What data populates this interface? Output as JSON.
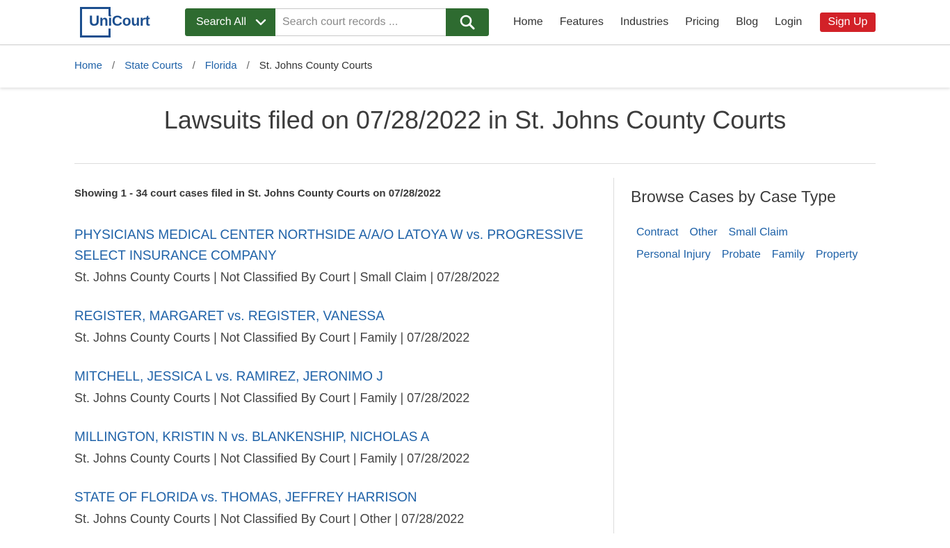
{
  "header": {
    "logo_text": "UniCourt",
    "search_all_label": "Search All",
    "search_placeholder": "Search court records ...",
    "nav": [
      "Home",
      "Features",
      "Industries",
      "Pricing",
      "Blog",
      "Login"
    ],
    "signup_label": "Sign Up"
  },
  "breadcrumb": {
    "items": [
      "Home",
      "State Courts",
      "Florida"
    ],
    "current": "St. Johns County Courts"
  },
  "page_title": "Lawsuits filed on 07/28/2022 in St. Johns County Courts",
  "showing": "Showing 1 - 34 court cases filed in St. Johns County Courts on 07/28/2022",
  "cases": [
    {
      "title_line1": "PHYSICIANS MEDICAL CENTER NORTHSIDE A/A/O LATOYA W vs. PROGRESSIVE",
      "title_line2": "SELECT INSURANCE COMPANY",
      "meta": "St. Johns County Courts | Not Classified By Court | Small Claim | 07/28/2022"
    },
    {
      "title_line1": "REGISTER, MARGARET vs. REGISTER, VANESSA",
      "title_line2": "",
      "meta": "St. Johns County Courts | Not Classified By Court | Family | 07/28/2022"
    },
    {
      "title_line1": "MITCHELL, JESSICA L vs. RAMIREZ, JERONIMO J",
      "title_line2": "",
      "meta": "St. Johns County Courts | Not Classified By Court | Family | 07/28/2022"
    },
    {
      "title_line1": "MILLINGTON, KRISTIN N vs. BLANKENSHIP, NICHOLAS A",
      "title_line2": "",
      "meta": "St. Johns County Courts | Not Classified By Court | Family | 07/28/2022"
    },
    {
      "title_line1": "STATE OF FLORIDA vs. THOMAS, JEFFREY HARRISON",
      "title_line2": "",
      "meta": "St. Johns County Courts | Not Classified By Court | Other | 07/28/2022"
    }
  ],
  "sidebar": {
    "heading": "Browse Cases by Case Type",
    "case_types": [
      "Contract",
      "Other",
      "Small Claim",
      "Personal Injury",
      "Probate",
      "Family",
      "Property"
    ]
  },
  "colors": {
    "brand_blue": "#1c4f8f",
    "link_blue": "#1f62a8",
    "search_green": "#2e6b30",
    "signup_red": "#d22128"
  },
  "icons": {
    "search_button": "search-icon",
    "dropdown": "chevron-down-icon"
  }
}
